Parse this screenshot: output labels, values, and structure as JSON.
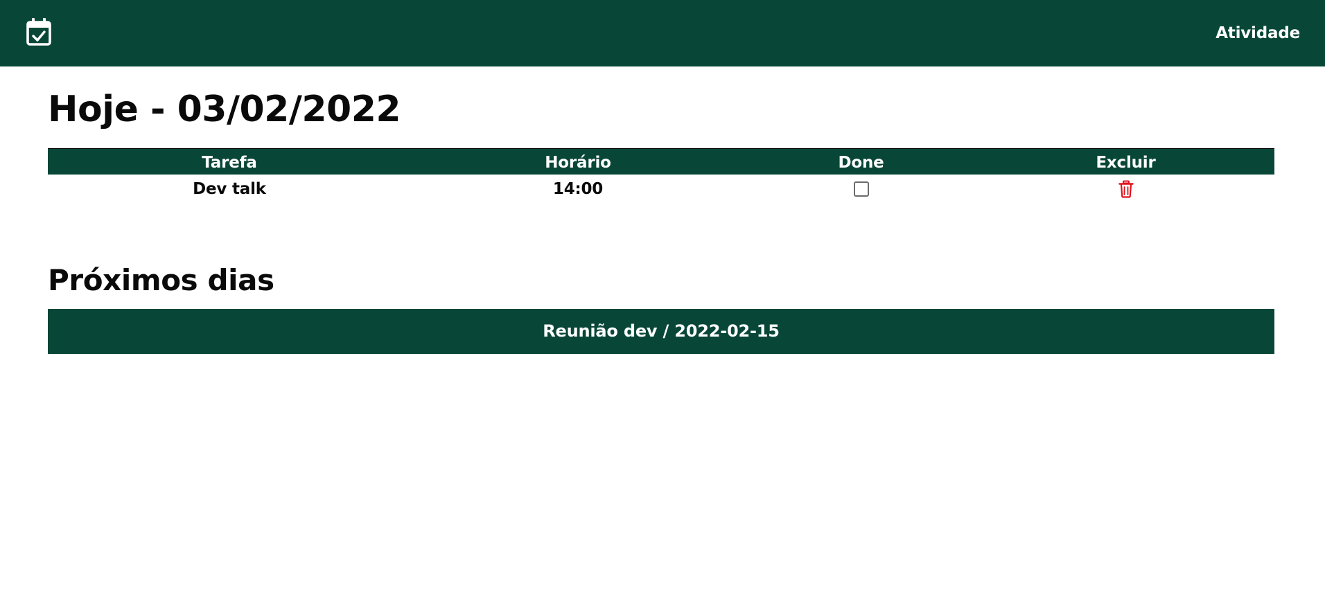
{
  "header": {
    "logo_icon": "calendar-check-icon",
    "nav_link": "Atividade",
    "background": "#084737"
  },
  "today": {
    "title": "Hoje - 03/02/2022",
    "table": {
      "headers": [
        "Tarefa",
        "Horário",
        "Done",
        "Excluir"
      ],
      "rows": [
        {
          "task": "Dev talk",
          "time": "14:00",
          "done": false,
          "delete_icon": "trash-icon"
        }
      ]
    }
  },
  "upcoming": {
    "title": "Próximos dias",
    "items": [
      {
        "label": "Reunião dev / 2022-02-15"
      }
    ]
  },
  "colors": {
    "brand": "#084737",
    "delete": "#e0101a",
    "text": "#0a0a0a"
  }
}
